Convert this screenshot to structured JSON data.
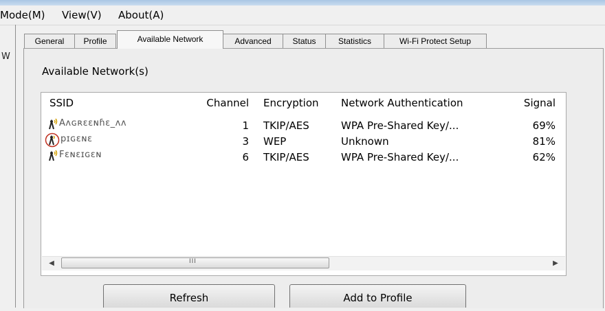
{
  "menubar": {
    "items": [
      "Mode(M)",
      "View(V)",
      "About(A)"
    ]
  },
  "left_fragment": "W",
  "tabs": [
    {
      "label": "General",
      "active": false
    },
    {
      "label": "Profile",
      "active": false
    },
    {
      "label": "Available Network",
      "active": true
    },
    {
      "label": "Advanced",
      "active": false
    },
    {
      "label": "Status",
      "active": false
    },
    {
      "label": "Statistics",
      "active": false
    },
    {
      "label": "Wi-Fi Protect Setup",
      "active": false
    }
  ],
  "group_label": "Available Network(s)",
  "table": {
    "columns": [
      "SSID",
      "Channel",
      "Encryption",
      "Network Authentication",
      "Signal"
    ],
    "rows": [
      {
        "ssid": "Aʌɢʀɛɛɴɦɛ_ʌʌ",
        "channel": "1",
        "encryption": "TKIP/AES",
        "auth": "WPA Pre-Shared Key/...",
        "signal": "69%",
        "connected": false
      },
      {
        "ssid": "pɪɢɛɴɛ",
        "channel": "3",
        "encryption": "WEP",
        "auth": "Unknown",
        "signal": "81%",
        "connected": true
      },
      {
        "ssid": "Fɛɴɛɪɢɛɴ",
        "channel": "6",
        "encryption": "TKIP/AES",
        "auth": "WPA Pre-Shared Key/...",
        "signal": "62%",
        "connected": false
      }
    ]
  },
  "scrollbar": {
    "left_arrow": "◀",
    "right_arrow": "▶",
    "grip": "III"
  },
  "buttons": {
    "refresh": "Refresh",
    "add_to_profile": "Add to Profile"
  }
}
